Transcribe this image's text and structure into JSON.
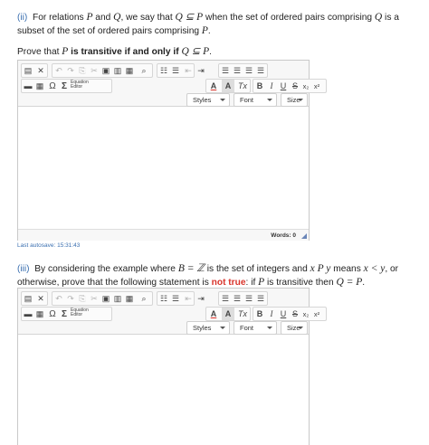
{
  "q2": {
    "num": "(ii)",
    "p1": "For relations ",
    "P": "P",
    "and": " and ",
    "Q": "Q",
    "p2": ", we say that ",
    "sub": "Q ⊆ P",
    "p3": " when the set of ordered pairs comprising ",
    "p4": " is a subset of the set of ordered pairs comprising ",
    "end": ".",
    "prove1": "Prove that ",
    "prove2": " is transitive ",
    "iff": "if and only if",
    "prove_sub": "Q ⊆ P",
    "prove_end": "."
  },
  "q3": {
    "num": "(iii)",
    "p1": "By considering the example where ",
    "BZ": "B = ℤ",
    "p2": " is the set of integers and ",
    "xPy": "x P y",
    "p3": " means ",
    "xy": "x < y",
    "p4": ", or otherwise, prove that the following statement is ",
    "nottrue": "not true",
    "p5": ": if ",
    "P": "P",
    "p6": " is transitive then ",
    "QP": "Q = P",
    "end": "."
  },
  "editor": {
    "equation_label_1": "Equation",
    "equation_label_2": "Editor",
    "styles": "Styles",
    "font": "Font",
    "size": "Size",
    "words": "Words: 0",
    "omega": "Ω",
    "sigma": "Σ",
    "bold": "B",
    "italic": "I",
    "underline": "U",
    "strike": "S",
    "sub": "x₂",
    "sup": "x²",
    "fontcolor": "A",
    "bgcolor": "A",
    "clearfmt": "Tx"
  },
  "autosave": "Last autosave: 15:31:43"
}
